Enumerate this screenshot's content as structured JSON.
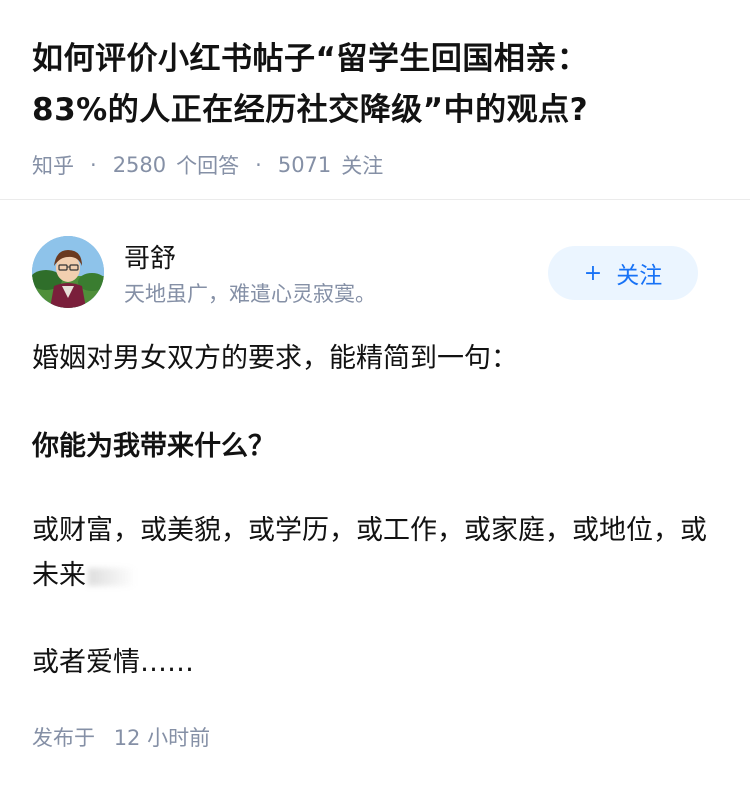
{
  "question": {
    "title_line1": "如何评价小红书帖子“留学生回国相亲：",
    "title_line2": "83%的人正在经历社交降级”中的观点?",
    "source": "知乎",
    "answers_count": "2580",
    "answers_label": "个回答",
    "followers_count": "5071",
    "followers_label": "关注"
  },
  "author": {
    "name": "哥舒",
    "bio": "天地虽广，难遣心灵寂寞。",
    "follow_label": "关注",
    "follow_icon": "plus-icon"
  },
  "answer": {
    "p1": "婚姻对男女双方的要求，能精简到一句：",
    "p2": "你能为我带来什么？",
    "p3": "或财富，或美貌，或学历，或工作，或家庭，或地位，或未来",
    "p4": "或者爱情……"
  },
  "footer": {
    "published_label": "发布于",
    "published_time": "12 小时前"
  },
  "colors": {
    "accent": "#1772f6",
    "follow_bg": "#ebf5ff",
    "meta": "#8590a6",
    "text": "#121212"
  }
}
